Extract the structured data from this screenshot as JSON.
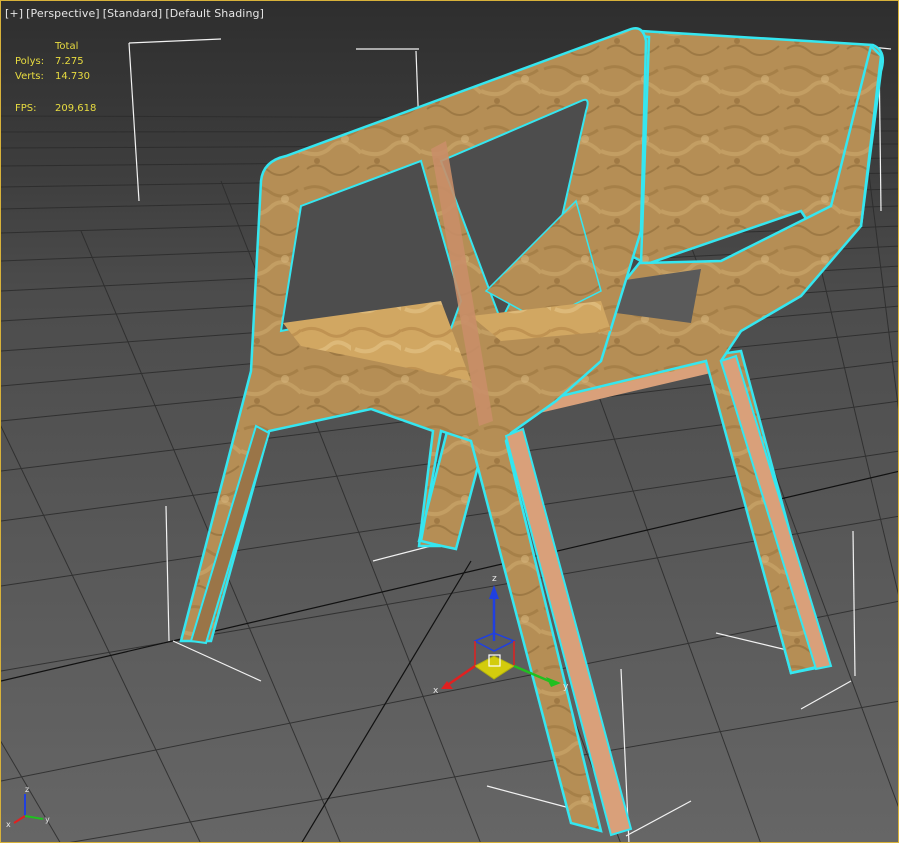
{
  "viewport": {
    "labels": {
      "plus": "[+]",
      "view": "[Perspective]",
      "style": "[Standard]",
      "shading": "[Default Shading]"
    }
  },
  "stats": {
    "header": "Total",
    "polys_label": "Polys:",
    "polys_value": "7.275",
    "verts_label": "Verts:",
    "verts_value": "14.730",
    "fps_label": "FPS:",
    "fps_value": "209,618"
  },
  "gizmo": {
    "x": "x",
    "y": "y",
    "z": "z"
  },
  "axis_tripod": {
    "x": "x",
    "y": "y",
    "z": "z"
  },
  "colors": {
    "selection_outline": "#35e6f0",
    "viewport_border": "#d8b23a",
    "stats_text": "#e8dc40",
    "axis_x": "#e12020",
    "axis_y": "#20c020",
    "axis_z": "#2040e0",
    "wood": "#b68f55",
    "edge_banding": "#d9a07a"
  }
}
